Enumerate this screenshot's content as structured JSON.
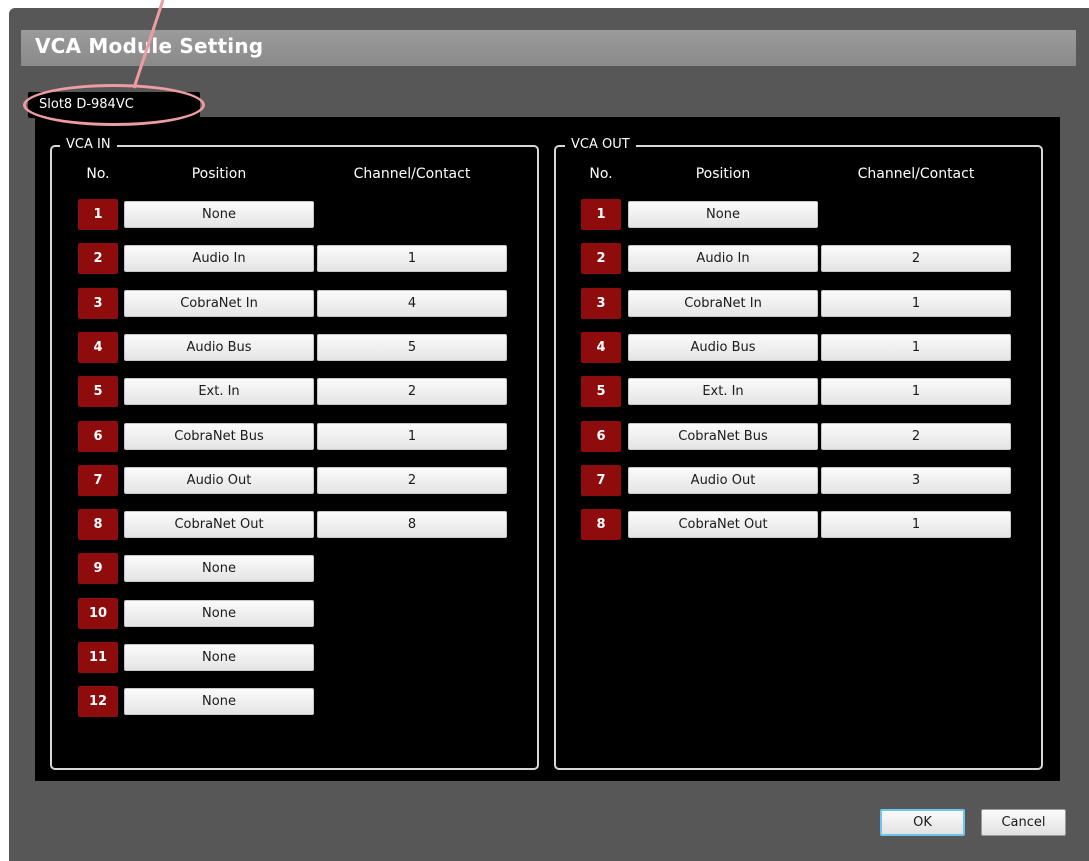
{
  "window": {
    "title": "VCA Module Setting"
  },
  "slot_tab": {
    "label": "Slot8  D-984VC"
  },
  "columns": {
    "no": "No.",
    "position": "Position",
    "channel": "Channel/Contact"
  },
  "vca_in": {
    "title": "VCA IN",
    "rows": [
      {
        "no": "1",
        "position": "None"
      },
      {
        "no": "2",
        "position": "Audio In",
        "channel": "1"
      },
      {
        "no": "3",
        "position": "CobraNet In",
        "channel": "4"
      },
      {
        "no": "4",
        "position": "Audio Bus",
        "channel": "5"
      },
      {
        "no": "5",
        "position": "Ext. In",
        "channel": "2"
      },
      {
        "no": "6",
        "position": "CobraNet Bus",
        "channel": "1"
      },
      {
        "no": "7",
        "position": "Audio Out",
        "channel": "2"
      },
      {
        "no": "8",
        "position": "CobraNet Out",
        "channel": "8"
      },
      {
        "no": "9",
        "position": "None"
      },
      {
        "no": "10",
        "position": "None"
      },
      {
        "no": "11",
        "position": "None"
      },
      {
        "no": "12",
        "position": "None"
      }
    ]
  },
  "vca_out": {
    "title": "VCA OUT",
    "rows": [
      {
        "no": "1",
        "position": "None"
      },
      {
        "no": "2",
        "position": "Audio In",
        "channel": "2"
      },
      {
        "no": "3",
        "position": "CobraNet In",
        "channel": "1"
      },
      {
        "no": "4",
        "position": "Audio Bus",
        "channel": "1"
      },
      {
        "no": "5",
        "position": "Ext. In",
        "channel": "1"
      },
      {
        "no": "6",
        "position": "CobraNet Bus",
        "channel": "2"
      },
      {
        "no": "7",
        "position": "Audio Out",
        "channel": "3"
      },
      {
        "no": "8",
        "position": "CobraNet Out",
        "channel": "1"
      }
    ]
  },
  "buttons": {
    "ok": "OK",
    "cancel": "Cancel"
  },
  "colors": {
    "row_number_bg": "#8f0c0c",
    "highlight_ellipse": "#ee9ca3",
    "ok_focus_border": "#6cc6ec"
  }
}
